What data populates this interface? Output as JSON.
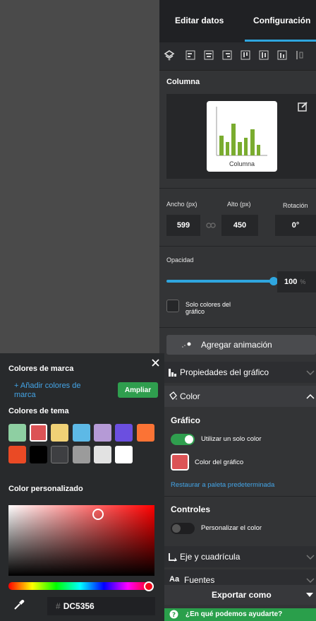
{
  "tabs": {
    "edit": "Editar datos",
    "config": "Configuración"
  },
  "chart_section": {
    "title": "Columna",
    "card_label": "Columna"
  },
  "dims": {
    "width_label": "Ancho (px)",
    "height_label": "Alto (px)",
    "rotation_label": "Rotación",
    "width": "599",
    "height": "450",
    "rotation": "0°"
  },
  "opacity": {
    "label": "Opacidad",
    "value": "100",
    "unit": "%",
    "level_percent": 100
  },
  "solo": {
    "label": "Solo colores del gráfico"
  },
  "animation": {
    "label": "Agregar animación"
  },
  "accordion": {
    "props": "Propiedades del gráfico",
    "color": "Color",
    "axis": "Eje y cuadrícula",
    "fonts": "Fuentes"
  },
  "grafico": {
    "title": "Gráfico",
    "single_color": "Utilizar un solo color",
    "chart_color": "Color del gráfico",
    "restore": "Restaurar a paleta predeterminada"
  },
  "controles": {
    "title": "Controles",
    "custom_color": "Personalizar el color"
  },
  "export": "Exportar como",
  "help": "¿En qué podemos ayudarte?",
  "picker": {
    "brand_title": "Colores de marca",
    "add_brand": "+ Añadir colores de marca",
    "ampliar": "Ampliar",
    "theme_title": "Colores de tema",
    "custom_title": "Color personalizado",
    "hash": "#",
    "hex": "DC5356",
    "theme_colors": [
      "#8ecfa2",
      "#dc5356",
      "#f0d176",
      "#5db9e6",
      "#b59ad6",
      "#6b4fe0",
      "#fb7335",
      "#ea4a25",
      "#000000",
      "#3e3f42",
      "#9b9b9b",
      "#e2e2e2",
      "#ffffff"
    ]
  },
  "colors": {
    "accent": "#2fa6df",
    "green": "#2f9e4e",
    "selected": "#dc5356",
    "bars": "#7aac2f"
  }
}
